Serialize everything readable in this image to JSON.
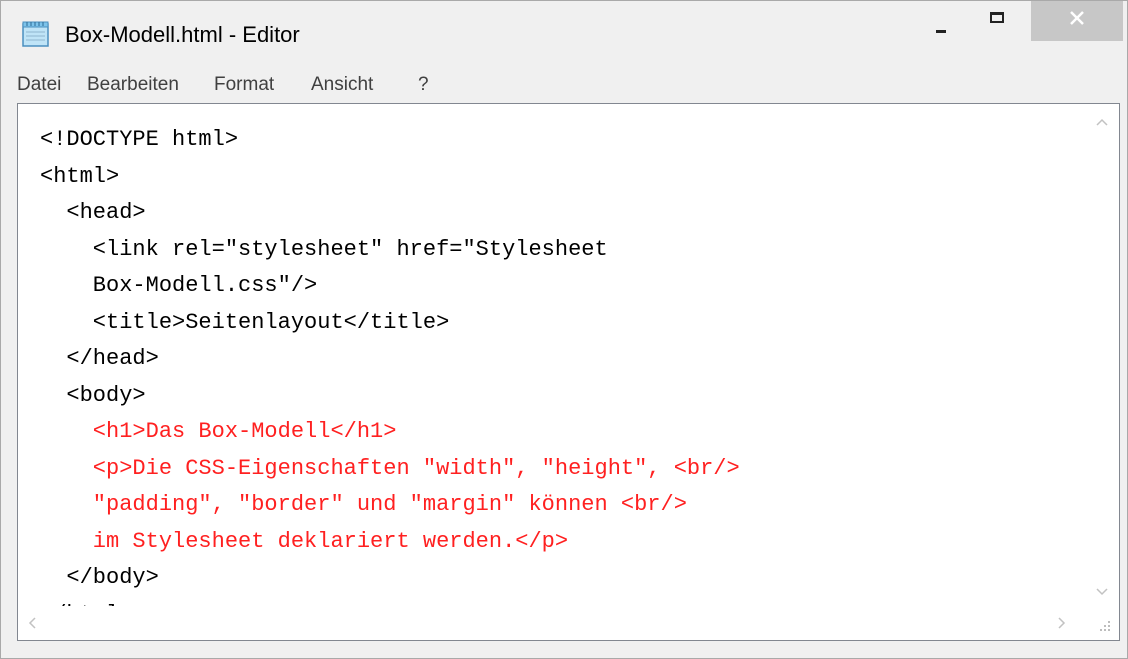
{
  "window": {
    "title": "Box-Modell.html - Editor",
    "controls": {
      "minimize_icon": "minimize-icon",
      "maximize_icon": "maximize-icon",
      "close_icon": "close-icon",
      "close_color": "#c7c7c7"
    }
  },
  "menu": {
    "items": [
      "Datei",
      "Bearbeiten",
      "Format",
      "Ansicht",
      "?"
    ]
  },
  "editor": {
    "highlight_color": "#ff2020",
    "lines": [
      {
        "text": "<!DOCTYPE html>",
        "highlight": false
      },
      {
        "text": "<html>",
        "highlight": false
      },
      {
        "text": "  <head>",
        "highlight": false
      },
      {
        "text": "    <link rel=\"stylesheet\" href=\"Stylesheet",
        "highlight": false
      },
      {
        "text": "    Box-Modell.css\"/>",
        "highlight": false
      },
      {
        "text": "    <title>Seitenlayout</title>",
        "highlight": false
      },
      {
        "text": "  </head>",
        "highlight": false
      },
      {
        "text": "  <body>",
        "highlight": false
      },
      {
        "text": "    <h1>Das Box-Modell</h1>",
        "highlight": true
      },
      {
        "text": "    <p>Die CSS-Eigenschaften \"width\", \"height\", <br/>",
        "highlight": true
      },
      {
        "text": "    \"padding\", \"border\" und \"margin\" können <br/>",
        "highlight": true
      },
      {
        "text": "    im Stylesheet deklariert werden.</p>",
        "highlight": true
      },
      {
        "text": "  </body>",
        "highlight": false
      },
      {
        "text": "</html>",
        "highlight": false
      }
    ]
  },
  "scrollbars": {
    "up_icon": "chevron-up-icon",
    "down_icon": "chevron-down-icon",
    "left_icon": "chevron-left-icon",
    "right_icon": "chevron-right-icon",
    "grip_icon": "resize-grip-icon"
  }
}
